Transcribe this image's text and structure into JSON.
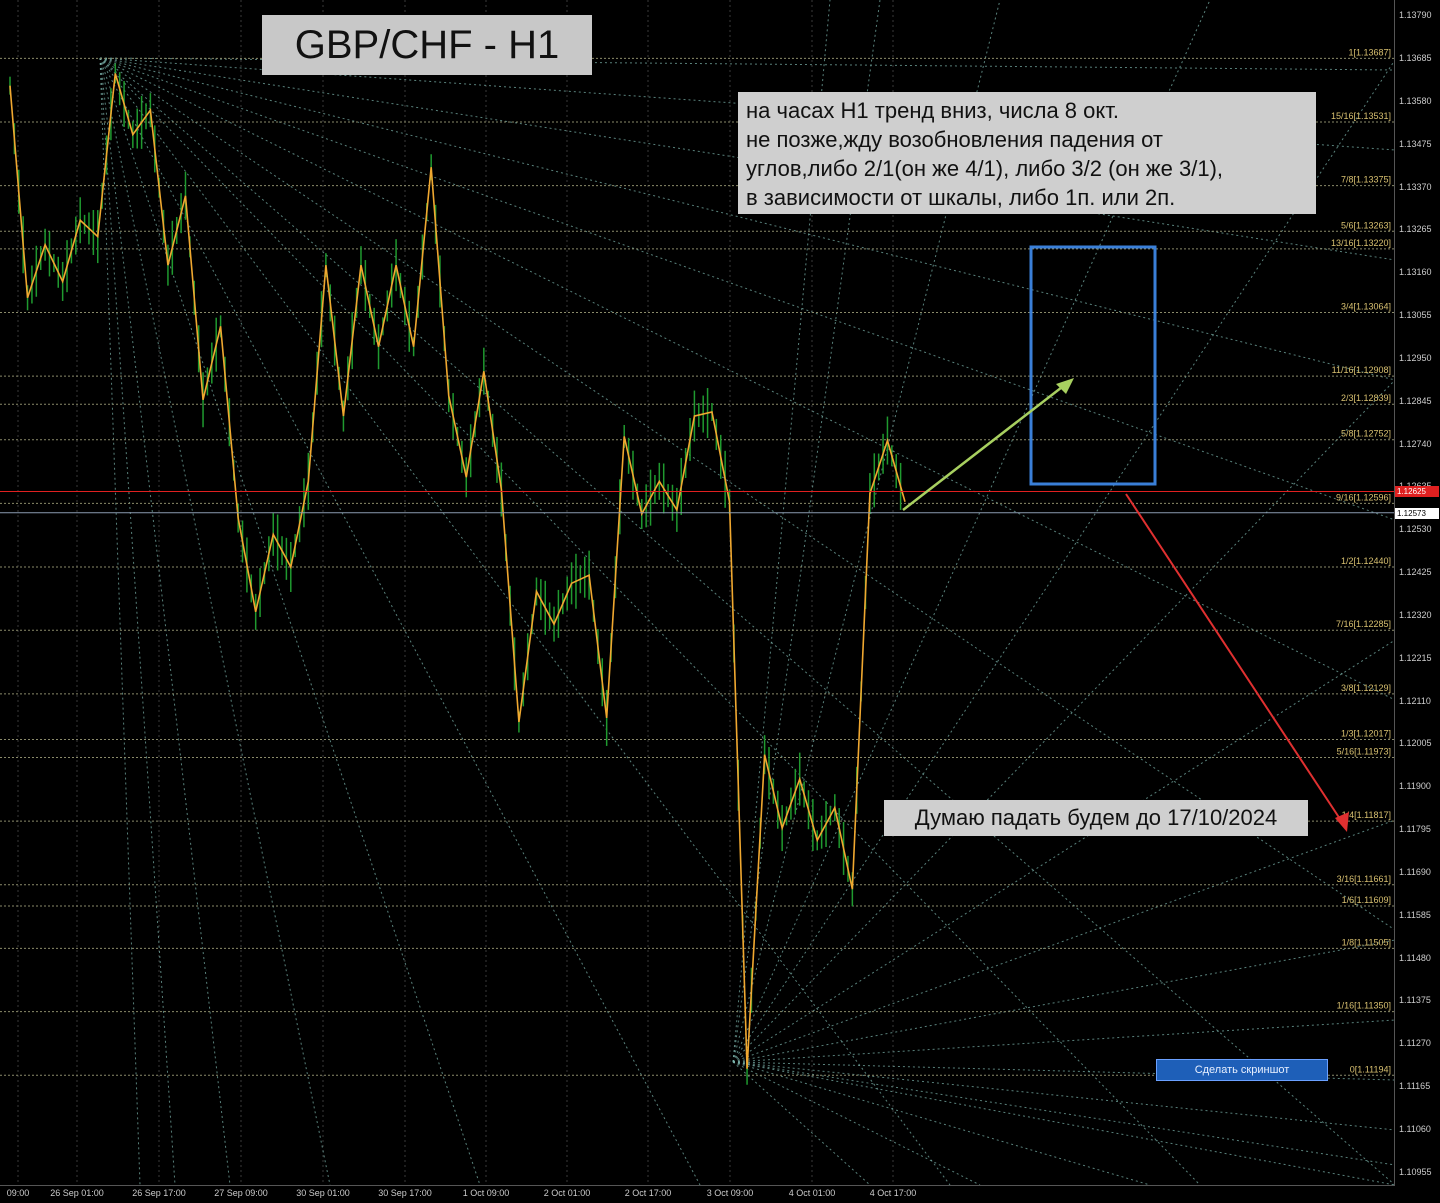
{
  "title": "GBP/CHF - H1",
  "note_lines": [
    "на часах Н1 тренд вниз, числа 8 окт.",
    "не позже,жду возобновления падения от",
    "углов,либо 2/1(он же 4/1), либо 3/2 (он же 3/1),",
    "в зависимости от шкалы, либо 1п. или 2п."
  ],
  "forecast_text": "Думаю падать будем до 17/10/2024",
  "screenshot_button": "Сделать скриншот",
  "current_price": "1.12573",
  "red_line_price": "1.12625",
  "colors": {
    "background": "#000000",
    "bull_bars": "#1f9a2f",
    "zigzag": "#f0a830",
    "level_lines": "#8a8a6a",
    "level_labels": "#d8c070",
    "fan_lines": "#7fb8b0",
    "red_line": "#e02020",
    "blue_box": "#3a7fd8",
    "green_arrow": "#a8d060",
    "red_arrow": "#e03030",
    "scale_text": "#cccccc"
  },
  "price_axis": [
    "1.13790",
    "1.13685",
    "1.13580",
    "1.13475",
    "1.13370",
    "1.13265",
    "1.13160",
    "1.13055",
    "1.12950",
    "1.12845",
    "1.12740",
    "1.12635",
    "1.12530",
    "1.12425",
    "1.12320",
    "1.12215",
    "1.12110",
    "1.12005",
    "1.11900",
    "1.11795",
    "1.11690",
    "1.11585",
    "1.11480",
    "1.11375",
    "1.11270",
    "1.11165",
    "1.11060",
    "1.10955"
  ],
  "time_axis": [
    "09:00",
    "26 Sep 01:00",
    "26 Sep 17:00",
    "27 Sep 09:00",
    "30 Sep 01:00",
    "30 Sep 17:00",
    "1 Oct 09:00",
    "2 Oct 01:00",
    "2 Oct 17:00",
    "3 Oct 09:00",
    "4 Oct 01:00",
    "4 Oct 17:00"
  ],
  "chart_data": {
    "type": "line",
    "title": "GBP/CHF - H1",
    "ylim": [
      1.10925,
      1.1383
    ],
    "levels": [
      {
        "label": "1[1.13687]",
        "price": 1.13687
      },
      {
        "label": "15/16[1.13531]",
        "price": 1.13531
      },
      {
        "label": "7/8[1.13375]",
        "price": 1.13375
      },
      {
        "label": "5/6[1.13263]",
        "price": 1.13263
      },
      {
        "label": "13/16[1.13220]",
        "price": 1.1322
      },
      {
        "label": "3/4[1.13064]",
        "price": 1.13064
      },
      {
        "label": "11/16[1.12908]",
        "price": 1.12908
      },
      {
        "label": "2/3[1.12839]",
        "price": 1.12839
      },
      {
        "label": "5/8[1.12752]",
        "price": 1.12752
      },
      {
        "label": "9/16[1.12596]",
        "price": 1.12596
      },
      {
        "label": "1/2[1.12440]",
        "price": 1.1244
      },
      {
        "label": "7/16[1.12285]",
        "price": 1.12285
      },
      {
        "label": "3/8[1.12129]",
        "price": 1.12129
      },
      {
        "label": "1/3[1.12017]",
        "price": 1.12017
      },
      {
        "label": "5/16[1.11973]",
        "price": 1.11973
      },
      {
        "label": "1/4[1.11817]",
        "price": 1.11817
      },
      {
        "label": "3/16[1.11661]",
        "price": 1.11661
      },
      {
        "label": "1/6[1.11609]",
        "price": 1.11609
      },
      {
        "label": "1/8[1.11505]",
        "price": 1.11505
      },
      {
        "label": "1/16[1.11350]",
        "price": 1.1135
      },
      {
        "label": "0[1.11194]",
        "price": 1.11194
      }
    ],
    "zigzag_prices": [
      1.1362,
      1.131,
      1.1323,
      1.1314,
      1.1329,
      1.1325,
      1.1365,
      1.135,
      1.1356,
      1.1318,
      1.1335,
      1.1285,
      1.1303,
      1.1256,
      1.1233,
      1.1252,
      1.1244,
      1.1265,
      1.1318,
      1.1281,
      1.1318,
      1.1298,
      1.1318,
      1.1298,
      1.1342,
      1.1286,
      1.1266,
      1.1292,
      1.1263,
      1.1206,
      1.1238,
      1.123,
      1.124,
      1.1242,
      1.1207,
      1.1276,
      1.1257,
      1.1265,
      1.1258,
      1.1281,
      1.1282,
      1.126,
      1.1121,
      1.1198,
      1.118,
      1.1192,
      1.1177,
      1.1185,
      1.1165,
      1.1262,
      1.1275,
      1.126
    ]
  }
}
